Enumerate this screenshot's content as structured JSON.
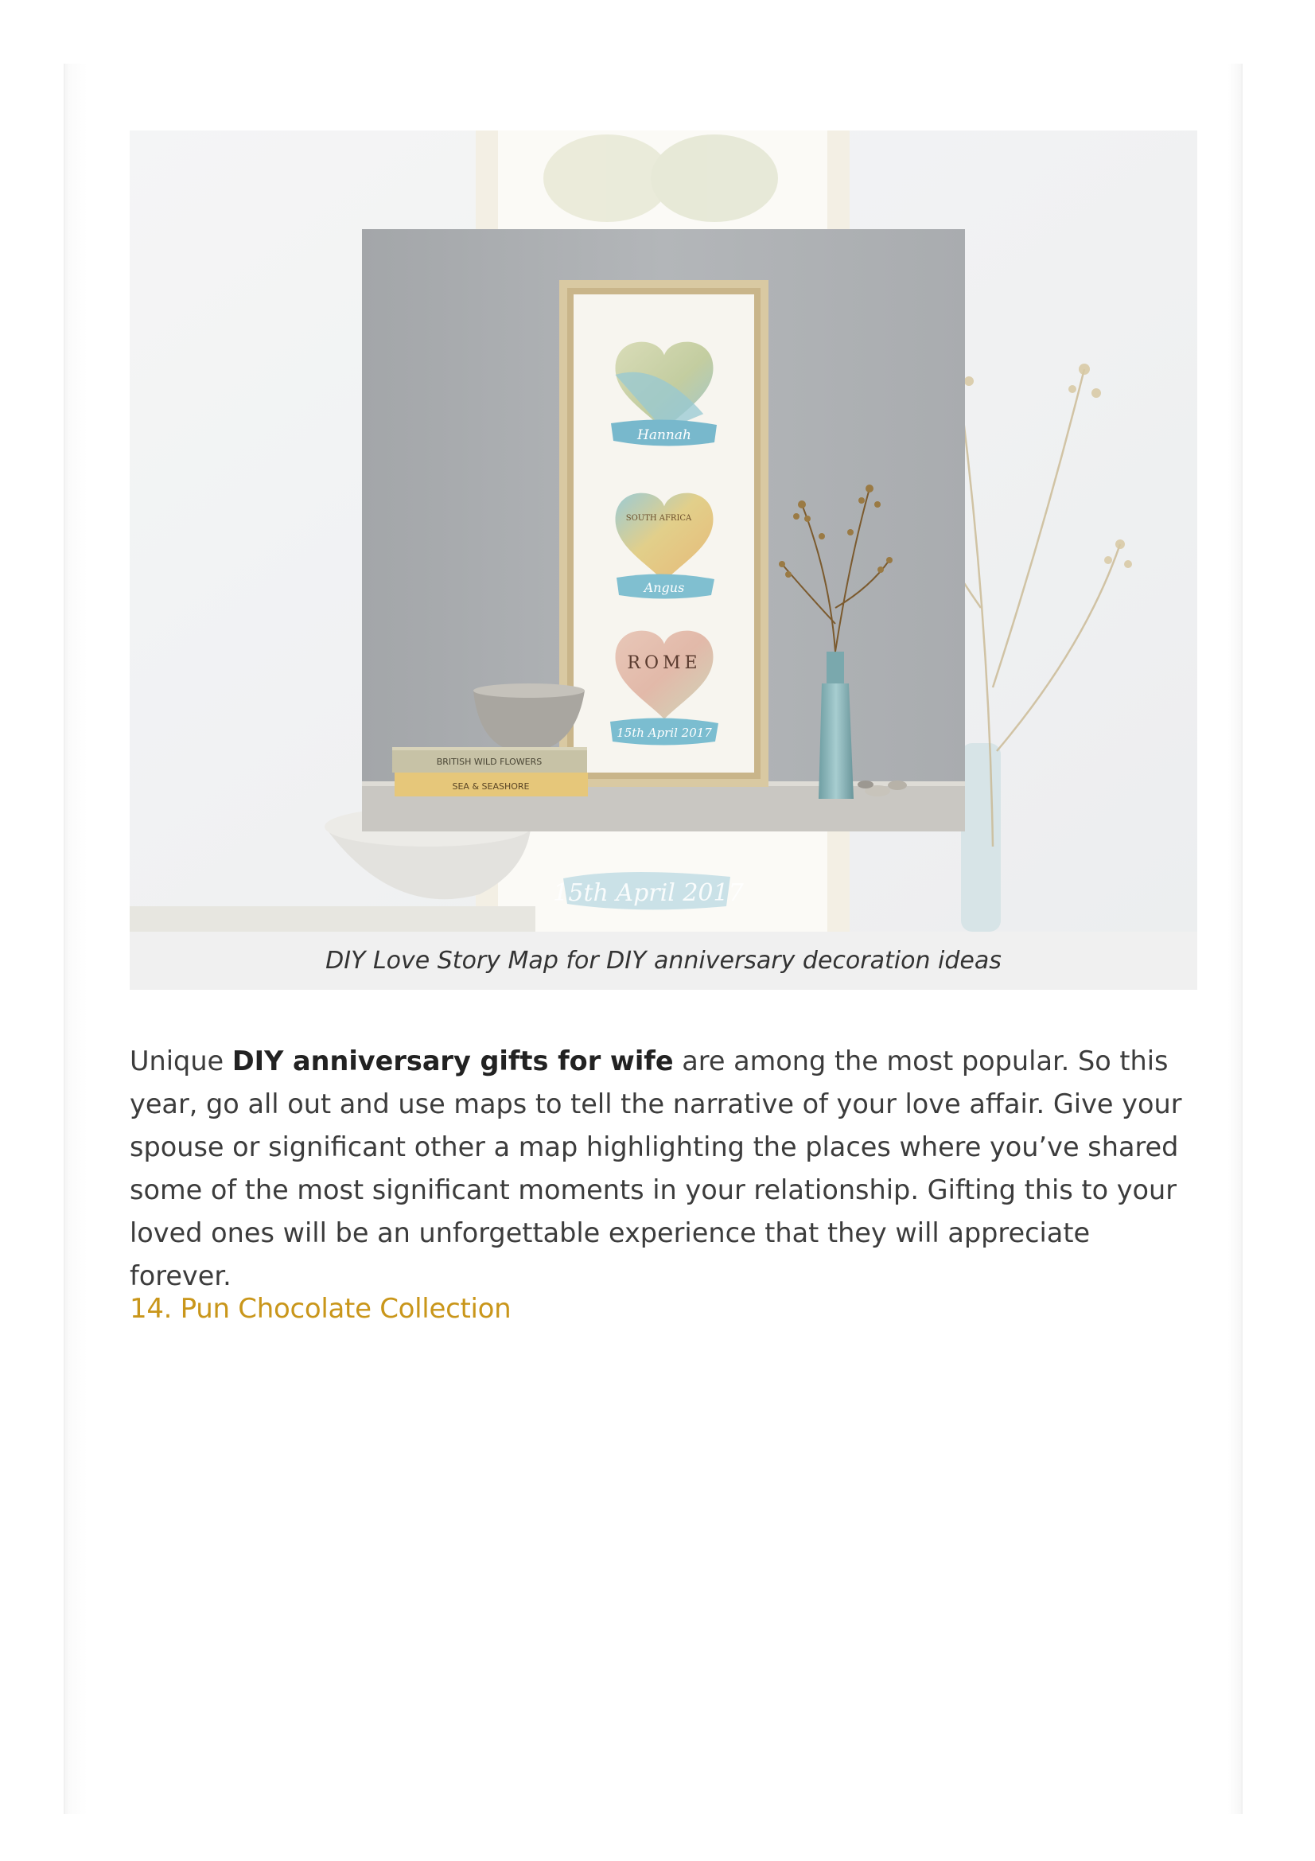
{
  "figure": {
    "photo_label": "DIY Love Story Map photo",
    "caption": "DIY Love Story Map for DIY anniversary decoration ideas",
    "frame_labels": {
      "heart_1_name": "Hannah",
      "heart_2_place": "SOUTH AFRICA",
      "heart_2_name": "Angus",
      "heart_3_place": "ROME",
      "heart_3_date": "15th April 2017",
      "background_date": "15th April 2017"
    },
    "book_titles": [
      "BRITISH WILD FLOWERS",
      "SEA & SEASHORE"
    ]
  },
  "paragraph": {
    "before": "Unique ",
    "link_text": "DIY anniversary gifts for wife",
    "after": " are among the most popular. So this year, go all out and use maps to tell the narrative of your love affair. Give your spouse or significant other a map highlighting the places where you’ve shared some of the most significant moments in your relationship. Gifting this to your loved ones will be an unforgettable experience that they will appreciate forever."
  },
  "heading": {
    "text": "14. Pun Chocolate Collection"
  },
  "colors": {
    "heading": "#c9961a",
    "body_text": "#3c3c3c",
    "caption_bg": "#f0f0f0"
  }
}
